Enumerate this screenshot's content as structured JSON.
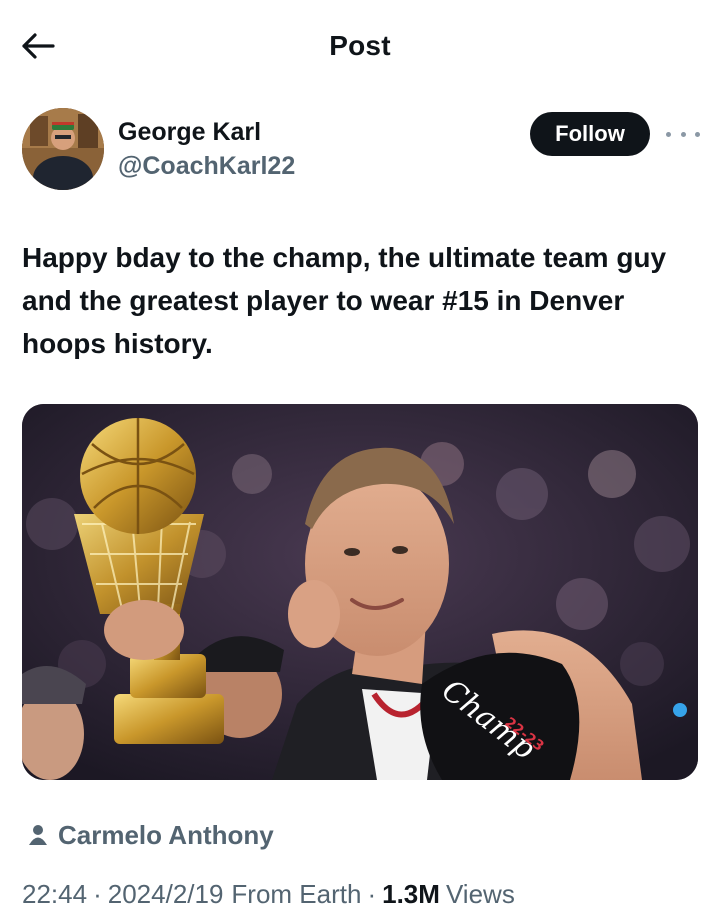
{
  "header": {
    "title": "Post",
    "back_icon": "arrow-left-icon"
  },
  "author": {
    "name": "George Karl",
    "handle": "@CoachKarl22",
    "follow_label": "Follow",
    "more_icon": "more-dots-icon"
  },
  "tweet": {
    "text": "Happy bday to the champ, the ultimate team guy and the greatest player to wear #15 in Denver hoops history."
  },
  "media": {
    "cap_text": "Champ",
    "cap_season": "22-23"
  },
  "credit": {
    "icon": "person-icon",
    "name": "Carmelo Anthony"
  },
  "meta": {
    "time": "22:44",
    "separator": "·",
    "date": "2024/2/19",
    "location": "From Earth",
    "views_count": "1.3M",
    "views_label": "Views"
  },
  "colors": {
    "text_primary": "#0f1419",
    "text_secondary": "#536471",
    "follow_bg": "#0f1419"
  }
}
